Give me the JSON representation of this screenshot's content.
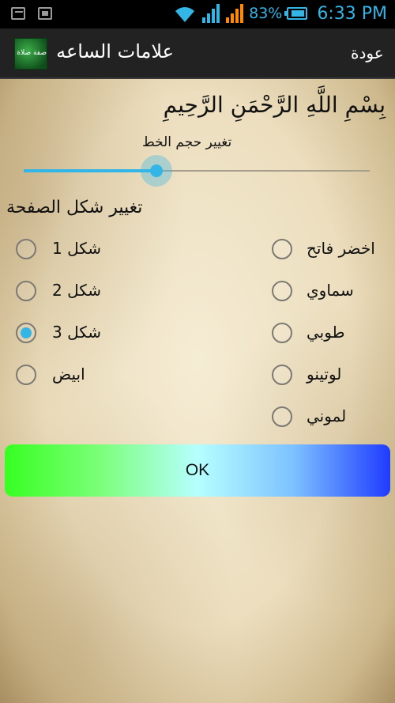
{
  "status_bar": {
    "battery_percent": "83%",
    "time": "6:33 PM",
    "icons": [
      "photo-notification-icon",
      "news-notification-icon",
      "wifi-icon",
      "signal-icon",
      "signal-roaming-icon",
      "battery-icon"
    ],
    "accent_color": "#33b5e5"
  },
  "action_bar": {
    "title": "علامات الساعه",
    "back_label": "عودة",
    "logo_text": "صفة صلاة النبي"
  },
  "content": {
    "basmala": "بِسْمِ اللَّهِ الرَّحْمَنِ الرَّحِيمِ",
    "font_size_label": "تغيير حجم الخط",
    "font_size_slider_value": 0.37,
    "shape_heading": "تغيير شكل الصفحة",
    "shape_options": [
      {
        "label": "شكل 1",
        "checked": false
      },
      {
        "label": "شكل 2",
        "checked": false
      },
      {
        "label": "شكل 3",
        "checked": true
      },
      {
        "label": "ابيض",
        "checked": false
      }
    ],
    "color_options": [
      {
        "label": "اخضر فاتح",
        "checked": false
      },
      {
        "label": "سماوي",
        "checked": false
      },
      {
        "label": "طوبي",
        "checked": false
      },
      {
        "label": "لوتينو",
        "checked": false
      },
      {
        "label": "لموني",
        "checked": false
      }
    ],
    "ok_label": "OK"
  }
}
